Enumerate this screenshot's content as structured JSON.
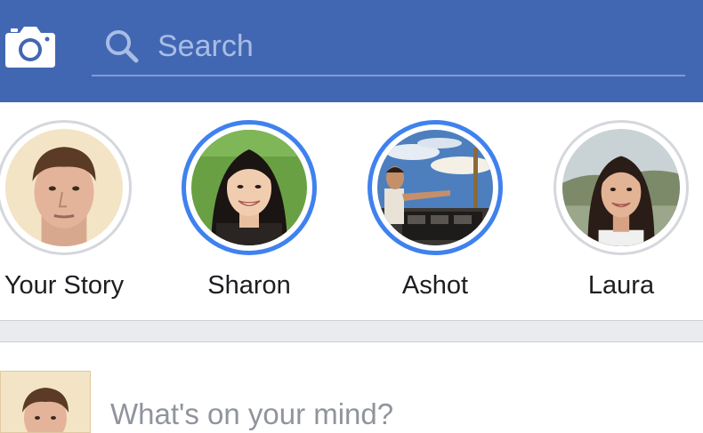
{
  "header": {
    "camera_icon": "camera-icon",
    "search": {
      "placeholder": "Search",
      "value": "",
      "icon": "search-icon"
    },
    "colors": {
      "bar": "#4267b2",
      "search_underline": "#7f9bd3",
      "placeholder": "#a8bde6"
    }
  },
  "stories": [
    {
      "name": "Your Story",
      "seen": true
    },
    {
      "name": "Sharon",
      "seen": false
    },
    {
      "name": "Ashot",
      "seen": false
    },
    {
      "name": "Laura",
      "seen": true
    }
  ],
  "composer": {
    "prompt": "What's on your mind?"
  },
  "colors": {
    "unseen_ring": "#3f82ef",
    "seen_ring": "#d4d7dc",
    "separator": "#e9ebee"
  }
}
